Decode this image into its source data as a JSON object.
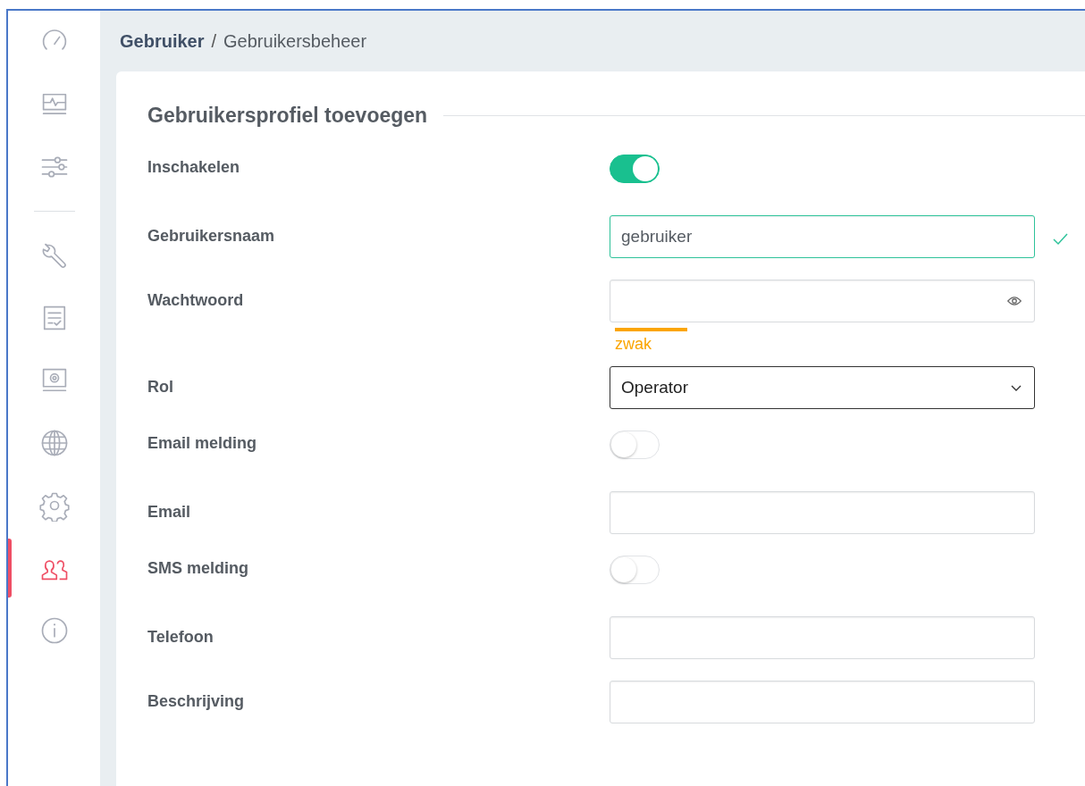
{
  "sidebar": {
    "items": [
      {
        "selected": false
      },
      {
        "selected": false
      },
      {
        "selected": false
      },
      {
        "selected": false
      },
      {
        "selected": false
      },
      {
        "selected": false
      },
      {
        "selected": false
      },
      {
        "selected": false
      },
      {
        "selected": true
      },
      {
        "selected": false
      }
    ]
  },
  "breadcrumb": {
    "parent": "Gebruiker",
    "separator": "/",
    "current": "Gebruikersbeheer"
  },
  "card": {
    "title": "Gebruikersprofiel toevoegen"
  },
  "rows": [
    {
      "kind": "toggle",
      "label": "Inschakelen",
      "on": true
    },
    {
      "kind": "text",
      "label": "Gebruikersnaam",
      "value": "gebruiker",
      "valid": true
    },
    {
      "kind": "password",
      "label": "Wachtwoord",
      "strength": "zwak"
    },
    {
      "kind": "select",
      "label": "Rol",
      "value": "Operator"
    },
    {
      "kind": "toggle",
      "label": "Email melding",
      "on": false
    },
    {
      "kind": "text",
      "label": "Email",
      "value": "",
      "valid": false
    },
    {
      "kind": "toggle",
      "label": "SMS melding",
      "on": false
    },
    {
      "kind": "text",
      "label": "Telefoon",
      "value": "",
      "valid": false
    },
    {
      "kind": "text",
      "label": "Beschrijving",
      "value": "",
      "valid": false
    }
  ]
}
